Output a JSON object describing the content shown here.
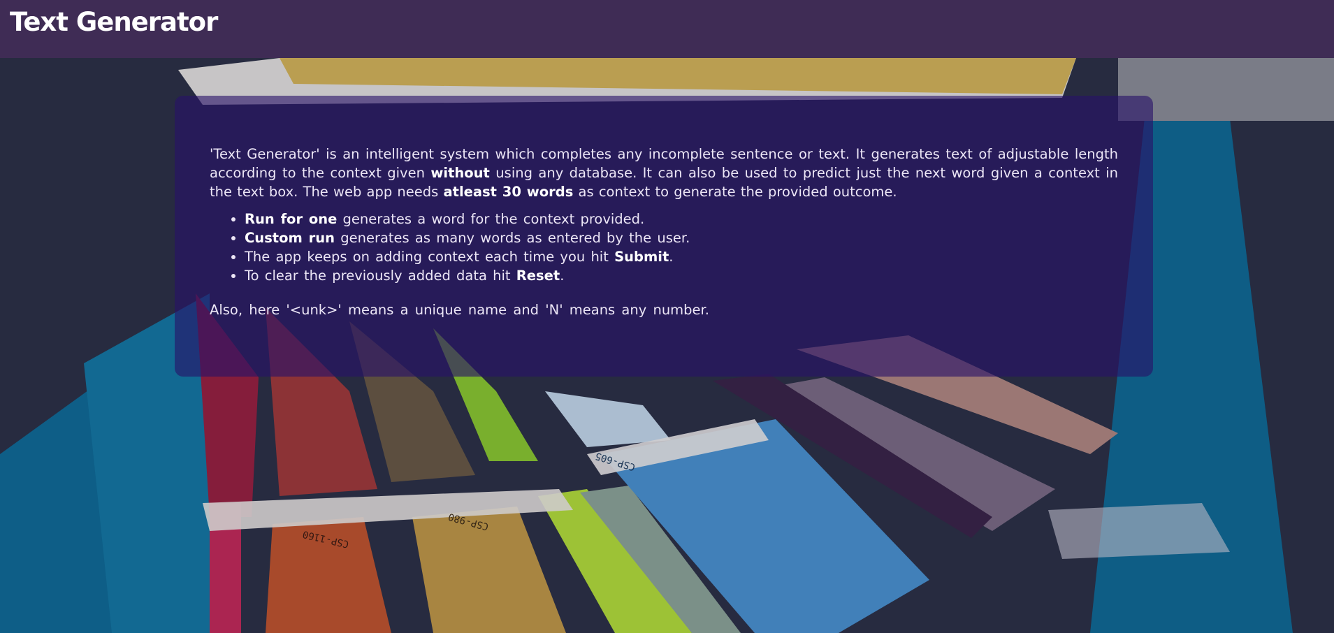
{
  "header": {
    "title": "Text Generator"
  },
  "info": {
    "intro": {
      "part1": "'Text Generator' is an intelligent system which completes any incomplete sentence or text. It generates text of adjustable length according to the context given ",
      "bold1": "without",
      "part2": " using any database. It can also be used to predict just the next word given a context in the text box. The web app needs ",
      "bold2": "atleast 30 words",
      "part3": " as context to generate the provided outcome."
    },
    "bullets": [
      {
        "bold": "Run for one",
        "text": " generates a word for the context provided."
      },
      {
        "bold": "Custom run",
        "text": " generates as many words as entered by the user."
      },
      {
        "pre": "The app keeps on adding context each time you hit ",
        "bold": "Submit",
        "post": "."
      },
      {
        "pre": "To clear the previously added data hit ",
        "bold": "Reset",
        "post": "."
      }
    ],
    "outro": "Also, here '<unk>' means a unique name and 'N' means any number."
  },
  "background": {
    "swatch_labels": [
      "CSP-605",
      "CSP-980",
      "CSP-1160"
    ]
  },
  "colors": {
    "header_bg": "#3f2c55",
    "panel_overlay": "rgba(40,18,105,0.62)"
  }
}
